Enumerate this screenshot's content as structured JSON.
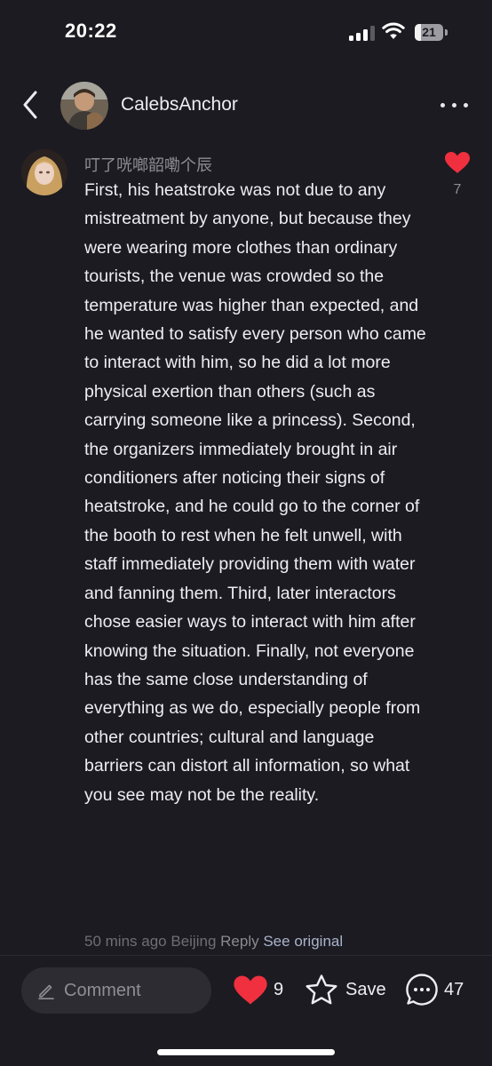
{
  "status_bar": {
    "time": "20:22",
    "battery_level": "21",
    "signal_bars_active": 3,
    "signal_bars_total": 4,
    "wifi_icon": "wifi-icon"
  },
  "header": {
    "back_icon": "chevron-left-icon",
    "username": "CalebsAnchor",
    "more_icon": "ellipsis-icon"
  },
  "comment": {
    "username": "叮了咣啷韶嘞个辰",
    "text": "First, his heatstroke was not due to any mistreatment by anyone, but because they were wearing more clothes than ordinary tourists, the venue was crowded so the temperature was higher than expected, and he wanted to satisfy every person who came to interact with him, so he did a lot more physical exertion than others (such as carrying someone like a princess). Second, the organizers immediately brought in air conditioners after noticing their signs of heatstroke, and he could go to the corner of the booth to rest when he felt unwell, with staff immediately providing them with water and fanning them. Third, later interactors chose easier ways to interact with him after knowing the situation. Finally, not everyone has the same close understanding of everything as we do, especially people from other countries; cultural and language barriers can distort all information, so what you see may not be the reality.",
    "like_count": "7",
    "liked": true,
    "time_ago": "50 mins ago",
    "location": "Beijing",
    "reply_label": "Reply",
    "see_original_label": "See original"
  },
  "bottom_bar": {
    "comment_placeholder": "Comment",
    "like_count": "9",
    "save_label": "Save",
    "comment_count": "47"
  },
  "colors": {
    "background": "#1c1b21",
    "like_red": "#f0303f",
    "link_blue": "#aab3cc",
    "muted_text": "#8e8d94"
  }
}
